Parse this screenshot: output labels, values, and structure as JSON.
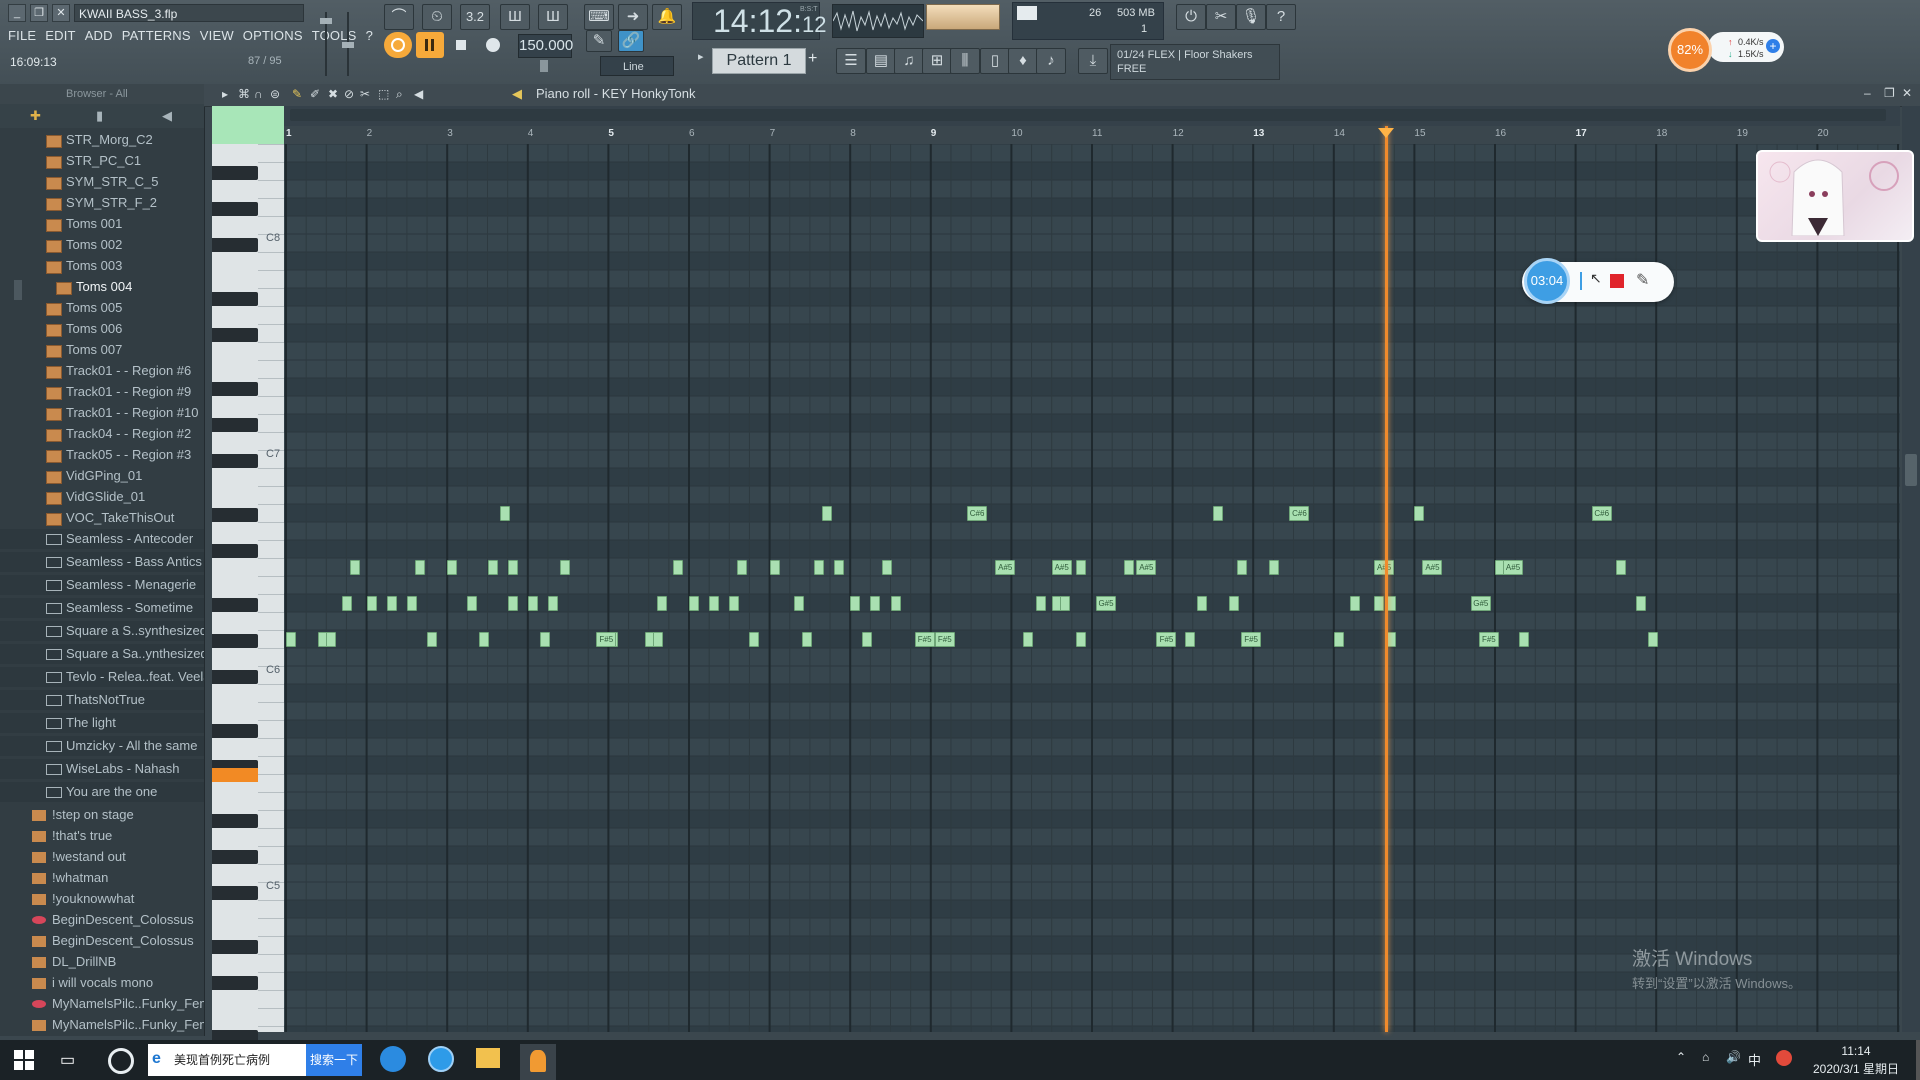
{
  "window": {
    "filename": "KWAII BASS_3.flp",
    "btn_min": "_",
    "btn_restore": "❐",
    "btn_close": "✕"
  },
  "menu": [
    "FILE",
    "EDIT",
    "ADD",
    "PATTERNS",
    "VIEW",
    "OPTIONS",
    "TOOLS",
    "?"
  ],
  "status": {
    "song_time": "16:09:13",
    "memory_line": "87 / 95"
  },
  "transport": {
    "time_main": "14:12",
    "time_sub": "12",
    "time_label": "B:S:T",
    "tempo": "150.000",
    "snap": "Line",
    "cpu_value": "26",
    "ram": "503 MB",
    "poly": "1"
  },
  "pattern": {
    "label": "Pattern 1",
    "add": "+"
  },
  "hint": {
    "line1": "01/24  FLEX | Floor Shakers",
    "line2": "FREE"
  },
  "net": {
    "cpu": "82%",
    "up": "0.4K/s",
    "down": "1.5K/s"
  },
  "browser": {
    "header": "Browser - All",
    "items": [
      {
        "label": "STR_Morg_C2",
        "kind": "audio"
      },
      {
        "label": "STR_PC_C1",
        "kind": "audio"
      },
      {
        "label": "SYM_STR_C_5",
        "kind": "audio"
      },
      {
        "label": "SYM_STR_F_2",
        "kind": "audio"
      },
      {
        "label": "Toms 001",
        "kind": "audio"
      },
      {
        "label": "Toms 002",
        "kind": "audio"
      },
      {
        "label": "Toms 003",
        "kind": "audio"
      },
      {
        "label": "Toms 004",
        "kind": "audio-selected"
      },
      {
        "label": "Toms 005",
        "kind": "audio"
      },
      {
        "label": "Toms 006",
        "kind": "audio"
      },
      {
        "label": "Toms 007",
        "kind": "audio"
      },
      {
        "label": "Track01 - - Region #6",
        "kind": "audio"
      },
      {
        "label": "Track01 - - Region #9",
        "kind": "audio"
      },
      {
        "label": "Track01 - - Region #10",
        "kind": "audio"
      },
      {
        "label": "Track04 - - Region #2",
        "kind": "audio"
      },
      {
        "label": "Track05 - - Region #3",
        "kind": "audio"
      },
      {
        "label": "VidGPing_01",
        "kind": "audio"
      },
      {
        "label": "VidGSlide_01",
        "kind": "audio"
      },
      {
        "label": "VOC_TakeThisOut",
        "kind": "audio"
      },
      {
        "label": "Seamless - Antecoder",
        "kind": "folder"
      },
      {
        "label": "Seamless - Bass Antics",
        "kind": "folder"
      },
      {
        "label": "Seamless - Menagerie",
        "kind": "folder"
      },
      {
        "label": "Seamless - Sometime",
        "kind": "folder"
      },
      {
        "label": "Square a S..synthesized)",
        "kind": "folder"
      },
      {
        "label": "Square a Sa..ynthesized)",
        "kind": "folder"
      },
      {
        "label": "Tevlo - Relea..feat. Veela)",
        "kind": "folder"
      },
      {
        "label": "ThatsNotTrue",
        "kind": "folder"
      },
      {
        "label": "The light",
        "kind": "folder"
      },
      {
        "label": "Umzicky - All the same",
        "kind": "folder"
      },
      {
        "label": "WiseLabs - Nahash",
        "kind": "folder"
      },
      {
        "label": "You are the one",
        "kind": "folder"
      },
      {
        "label": "!step on stage",
        "kind": "project"
      },
      {
        "label": "!that's true",
        "kind": "project"
      },
      {
        "label": "!westand out",
        "kind": "project"
      },
      {
        "label": "!whatman",
        "kind": "project"
      },
      {
        "label": "!youknowwhat",
        "kind": "project"
      },
      {
        "label": "BeginDescent_Colossus",
        "kind": "plugin"
      },
      {
        "label": "BeginDescent_Colossus",
        "kind": "project"
      },
      {
        "label": "DL_DrillNB",
        "kind": "project"
      },
      {
        "label": "i will vocals mono",
        "kind": "project"
      },
      {
        "label": "MyNamelsPilc..Funky_Female",
        "kind": "plugin"
      },
      {
        "label": "MyNamelsPilc..Funky_Female",
        "kind": "project"
      }
    ]
  },
  "piano_roll": {
    "title": "Piano roll - KEY HonkyTonk",
    "bars": [
      "1",
      "2",
      "3",
      "4",
      "5",
      "6",
      "7",
      "8",
      "9",
      "10",
      "11",
      "12",
      "13",
      "14",
      "15",
      "16",
      "17",
      "18",
      "19",
      "20"
    ],
    "octaves": [
      "C8",
      "C7",
      "C6",
      "C5"
    ],
    "playhead_bar": 14.65,
    "notes": [
      {
        "row": "C#6",
        "starts": [
          3.65,
          7.65,
          12.5,
          15.0,
          17.2
        ],
        "labels": {
          "9.45": "C#6",
          "13.45": "C#6",
          "17.2": "C#6"
        }
      },
      {
        "row": "A#5",
        "starts": [
          1.8,
          2.6,
          3.0,
          3.5,
          3.75,
          4.4,
          5.8,
          6.6,
          7.0,
          7.55,
          7.8,
          8.4,
          10.8,
          11.4,
          12.8,
          13.2,
          16.0,
          17.5
        ],
        "labels": {
          "9.8": "A#5",
          "10.5": "A#5",
          "11.55": "A#5",
          "14.5": "A#5",
          "15.1": "A#5",
          "16.1": "A#5"
        }
      },
      {
        "row": "G#5",
        "starts": [
          1.7,
          2.0,
          2.25,
          2.5,
          3.25,
          3.75,
          4.0,
          4.25,
          5.6,
          6.0,
          6.25,
          6.5,
          7.3,
          8.0,
          8.25,
          8.5,
          10.3,
          10.5,
          10.6,
          12.3,
          12.7,
          14.2,
          14.5,
          14.65,
          17.75
        ],
        "labels": {
          "11.05": "G#5",
          "15.7": "G#5"
        }
      },
      {
        "row": "F#5",
        "starts": [
          1.0,
          1.4,
          1.5,
          2.75,
          3.4,
          4.15,
          5.0,
          5.45,
          5.55,
          6.75,
          7.4,
          8.15,
          10.15,
          10.8,
          12.15,
          12.9,
          14.0,
          14.65,
          16.3,
          17.9
        ],
        "labels": {
          "4.85": "F#5",
          "8.8": "F#5",
          "9.05": "F#5",
          "11.8": "F#5",
          "12.85": "F#5",
          "15.8": "F#5"
        }
      }
    ]
  },
  "recorder": {
    "time": "03:04"
  },
  "watermark": {
    "title": "激活 Windows",
    "subtitle": "转到“设置”以激活 Windows。"
  },
  "taskbar": {
    "search_text": "美现首例死亡病例",
    "search_button": "搜索一下",
    "time": "11:14",
    "date": "2020/3/1 星期日",
    "ime": "中"
  }
}
